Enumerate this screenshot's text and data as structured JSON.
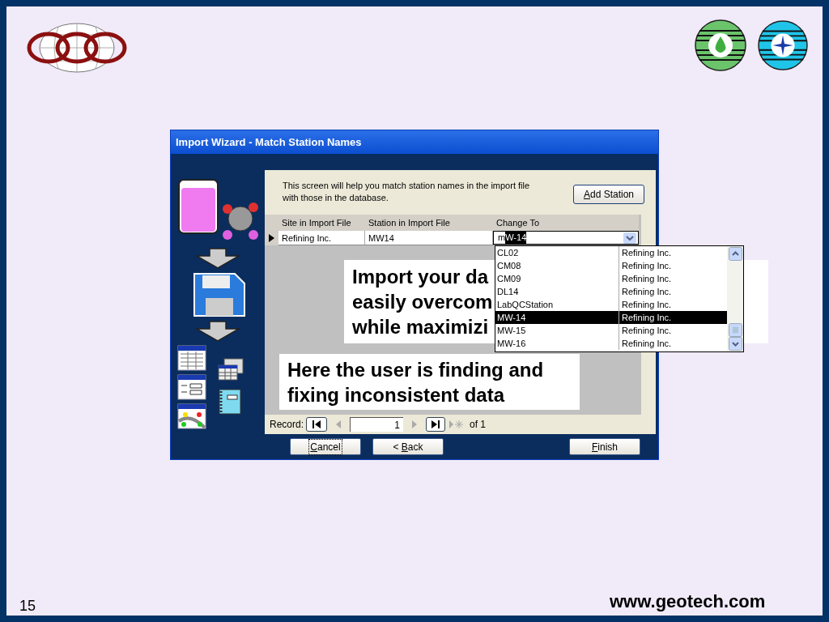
{
  "slide": {
    "page_number": "15",
    "url": "www.geotech.com"
  },
  "window": {
    "title": "Import Wizard - Match Station Names",
    "intro": "This screen will help you match station names in the import file with those in the database.",
    "add_button": {
      "key": "A",
      "suffix": "dd Station"
    },
    "grid": {
      "columns": [
        "Site in Import File",
        "Station in Import File",
        "Change To"
      ],
      "rows": [
        {
          "site": "Refining Inc.",
          "station": "MW14",
          "typed": "m",
          "completion": "W-14",
          "current": true
        }
      ]
    },
    "dropdown": [
      {
        "station": "CL02",
        "site": "Refining Inc.",
        "selected": false
      },
      {
        "station": "CM08",
        "site": "Refining Inc.",
        "selected": false
      },
      {
        "station": "CM09",
        "site": "Refining Inc.",
        "selected": false
      },
      {
        "station": "DL14",
        "site": "Refining Inc.",
        "selected": false
      },
      {
        "station": "LabQCStation",
        "site": "Refining Inc.",
        "selected": false
      },
      {
        "station": "MW-14",
        "site": "Refining Inc.",
        "selected": true
      },
      {
        "station": "MW-15",
        "site": "Refining Inc.",
        "selected": false
      },
      {
        "station": "MW-16",
        "site": "Refining Inc.",
        "selected": false
      }
    ],
    "record_nav": {
      "label": "Record:",
      "value": "1",
      "total": "of 1"
    },
    "buttons": [
      {
        "key": "C",
        "suffix": "ancel",
        "focused": true
      },
      {
        "prefix": "< ",
        "key": "B",
        "suffix": "ack",
        "focused": false
      },
      {
        "key": "F",
        "suffix": "inish",
        "focused": false
      }
    ]
  },
  "callouts": [
    {
      "lines": [
        "Import your da",
        "easily overcom",
        "while maximizi"
      ]
    },
    {
      "lines": [
        "Here the user is finding and",
        "fixing inconsistent data"
      ]
    }
  ]
}
